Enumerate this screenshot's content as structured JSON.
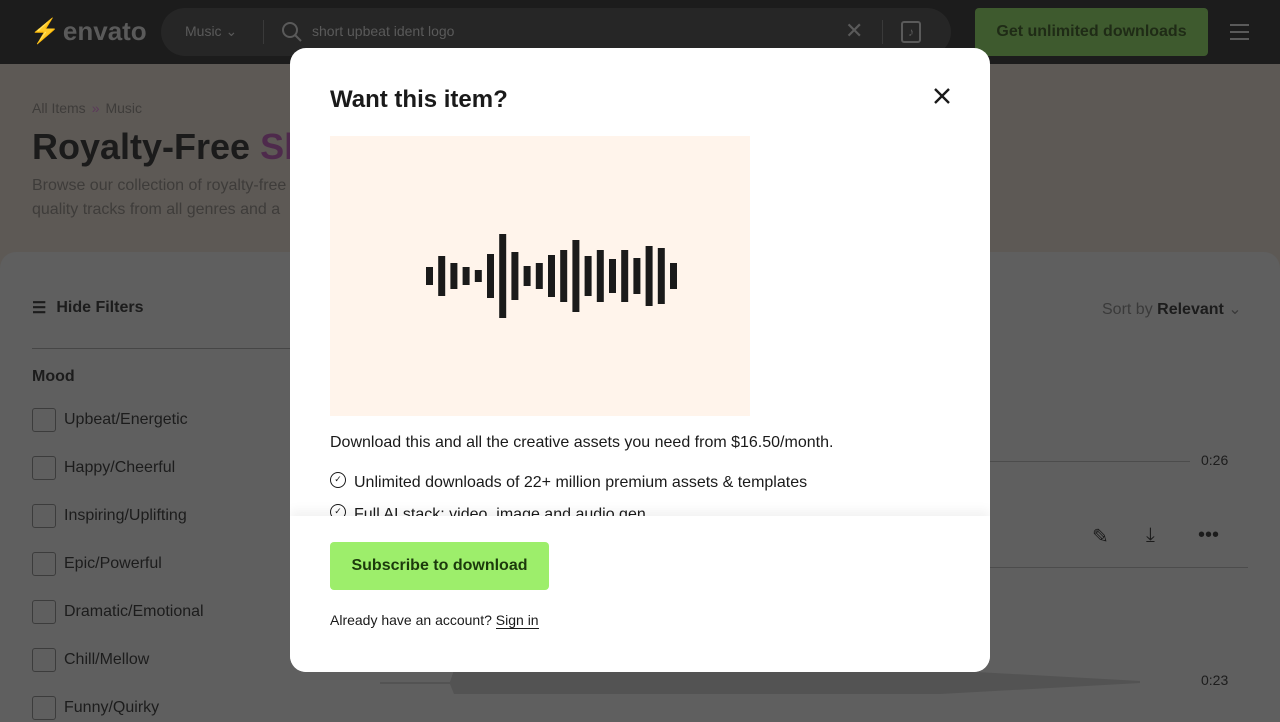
{
  "header": {
    "logo": "envato",
    "category": "Music",
    "query": "short upbeat ident logo",
    "cta": "Get unlimited downloads"
  },
  "hero": {
    "breadcrumb": [
      "All Items",
      "Music"
    ],
    "breadcrumb_sep": "»",
    "title_prefix": "Royalty-Free ",
    "title_highlight": "Sh",
    "description_lines": [
      "Browse our collection of royalty-free",
      "quality tracks from all genres and a"
    ]
  },
  "filters": {
    "toggle": "Hide Filters",
    "mood_heading": "Mood",
    "moods": [
      "Upbeat/Energetic",
      "Happy/Cheerful",
      "Inspiring/Uplifting",
      "Epic/Powerful",
      "Dramatic/Emotional",
      "Chill/Mellow",
      "Funny/Quirky"
    ]
  },
  "sort": {
    "label": "Sort by",
    "value": "Relevant"
  },
  "tracks": [
    {
      "duration": "0:26"
    },
    {
      "duration": "0:23"
    }
  ],
  "modal": {
    "title": "Want this item?",
    "description": "Download this and all the creative assets you need from $16.50/month.",
    "features": [
      "Unlimited downloads of 22+ million premium assets & templates",
      "Full AI stack: video, image and audio gen"
    ],
    "subscribe": "Subscribe to download",
    "account_prompt": "Already have an account?",
    "sign_in": "Sign in"
  }
}
